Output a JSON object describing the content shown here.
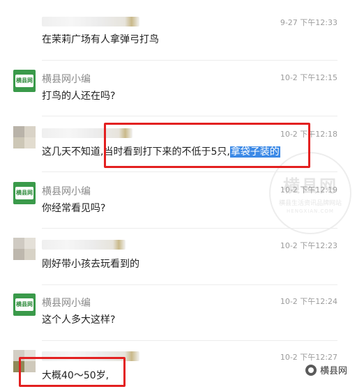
{
  "comments": [
    {
      "author": "",
      "author_blurred": true,
      "time": "9-27 下午12:33",
      "text": "在茉莉广场有人拿弹弓打鸟",
      "avatar": "none"
    },
    {
      "author": "横县网小编",
      "author_blurred": false,
      "time": "10-2 下午12:15",
      "text": "打鸟的人还在吗?",
      "avatar": "logo"
    },
    {
      "author": "",
      "author_blurred": true,
      "time": "10-2 下午12:18",
      "text_before": "这几天不知道,",
      "text_boxed": "当时看到打下来的不低于5只,",
      "text_highlight": "拿袋子装的",
      "avatar": "blur"
    },
    {
      "author": "横县网小编",
      "author_blurred": false,
      "time": "10-2 下午12:19",
      "text": "你经常看见吗?",
      "avatar": "logo"
    },
    {
      "author": "",
      "author_blurred": true,
      "time": "10-2 下午12:23",
      "text": "刚好带小孩去玩看到的",
      "avatar": "blur"
    },
    {
      "author": "横县网小编",
      "author_blurred": false,
      "time": "10-2 下午12:24",
      "text": "这个人多大这样?",
      "avatar": "logo"
    },
    {
      "author": "",
      "author_blurred": true,
      "time": "10-2 下午12:27",
      "text": "大概40～50岁,",
      "avatar": "blur"
    }
  ],
  "logo_text": "横县网",
  "watermark": {
    "big": "横县网",
    "small": "横县生活资讯品牌网站",
    "tiny": "HENGXIAN.COM"
  },
  "brand": {
    "label": "横县网"
  },
  "colors": {
    "highlight": "#3b89e6",
    "redbox": "#e32020",
    "logo_green": "#3a9a4a"
  }
}
